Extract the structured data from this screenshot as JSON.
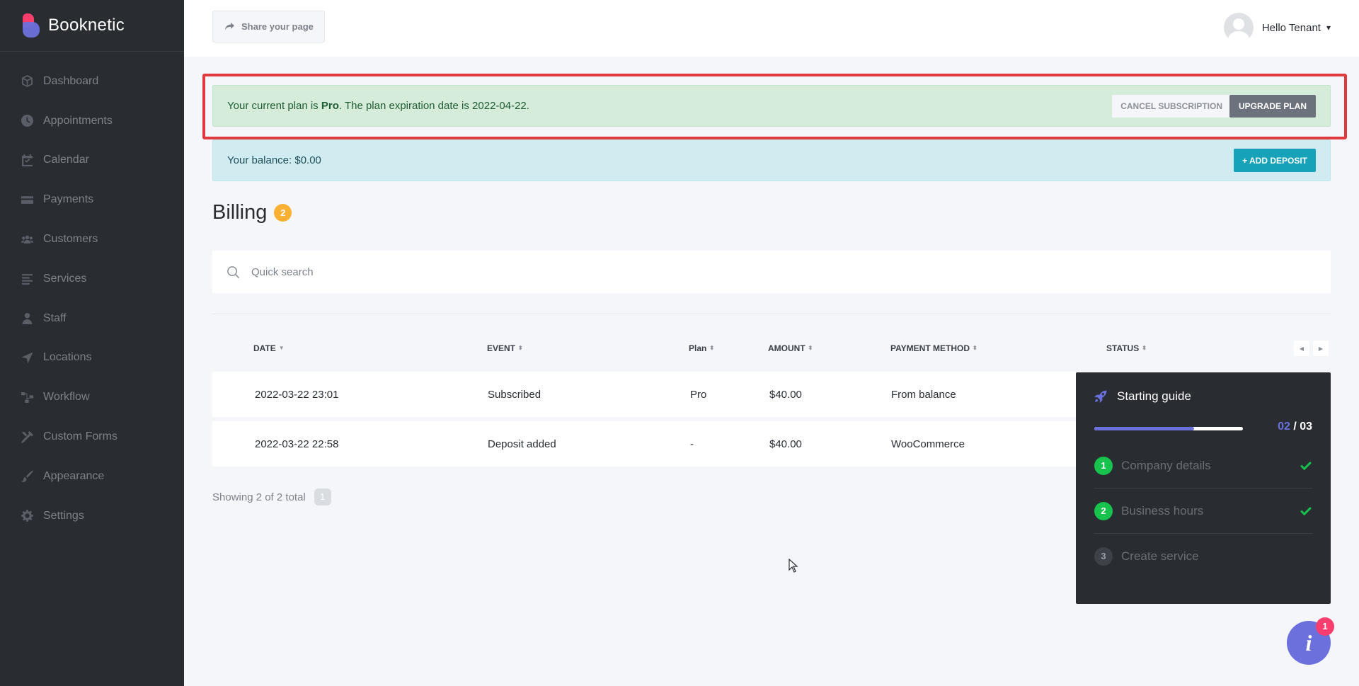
{
  "brand": {
    "name": "Booknetic"
  },
  "sidebar": {
    "items": [
      {
        "label": "Dashboard",
        "icon": "cube-icon"
      },
      {
        "label": "Appointments",
        "icon": "clock-icon"
      },
      {
        "label": "Calendar",
        "icon": "calendar-icon"
      },
      {
        "label": "Payments",
        "icon": "credit-card-icon"
      },
      {
        "label": "Customers",
        "icon": "users-icon"
      },
      {
        "label": "Services",
        "icon": "list-icon"
      },
      {
        "label": "Staff",
        "icon": "user-icon"
      },
      {
        "label": "Locations",
        "icon": "location-arrow-icon"
      },
      {
        "label": "Workflow",
        "icon": "workflow-icon"
      },
      {
        "label": "Custom Forms",
        "icon": "tools-icon"
      },
      {
        "label": "Appearance",
        "icon": "paint-brush-icon"
      },
      {
        "label": "Settings",
        "icon": "gear-icon"
      }
    ]
  },
  "header": {
    "share_label": "Share your page",
    "user_name": "Hello Tenant",
    "chevron": "⌄"
  },
  "plan_alert": {
    "prefix": "Your current plan is ",
    "plan": "Pro",
    "suffix": ". The plan expiration date is 2022-04-22.",
    "cancel_label": "CANCEL SUBSCRIPTION",
    "upgrade_label": "UPGRADE PLAN"
  },
  "balance_alert": {
    "text": "Your balance: $0.00",
    "deposit_label": "+ ADD DEPOSIT"
  },
  "page": {
    "title": "Billing",
    "count": "2"
  },
  "search": {
    "placeholder": "Quick search",
    "value": ""
  },
  "table": {
    "columns": [
      "DATE",
      "EVENT",
      "Plan",
      "AMOUNT",
      "PAYMENT METHOD",
      "STATUS"
    ],
    "sort_default": "▼",
    "sort_both": "⇕",
    "rows": [
      {
        "date": "2022-03-22 23:01",
        "event": "Subscribed",
        "plan": "Pro",
        "amount": "$40.00",
        "method": "From balance"
      },
      {
        "date": "2022-03-22 22:58",
        "event": "Deposit added",
        "plan": "-",
        "amount": "$40.00",
        "method": "WooCommerce"
      }
    ],
    "showing": "Showing 2 of 2 total",
    "page": "1",
    "prev": "◀",
    "next": "▶"
  },
  "guide": {
    "title": "Starting guide",
    "current": "02",
    "total": "/ 03",
    "progress": 0.67,
    "steps": [
      {
        "num": "1",
        "label": "Company details",
        "done": true
      },
      {
        "num": "2",
        "label": "Business hours",
        "done": true
      },
      {
        "num": "3",
        "label": "Create service",
        "done": false
      }
    ]
  },
  "fab": {
    "icon_text": "i",
    "badge": "1"
  },
  "colors": {
    "sidebar_bg": "#292d32",
    "accent": "#6c70dc",
    "highlight_frame": "#e03a3e",
    "success": "#17c24d",
    "info_button": "#16a2b8",
    "badge_orange": "#fbb032"
  }
}
